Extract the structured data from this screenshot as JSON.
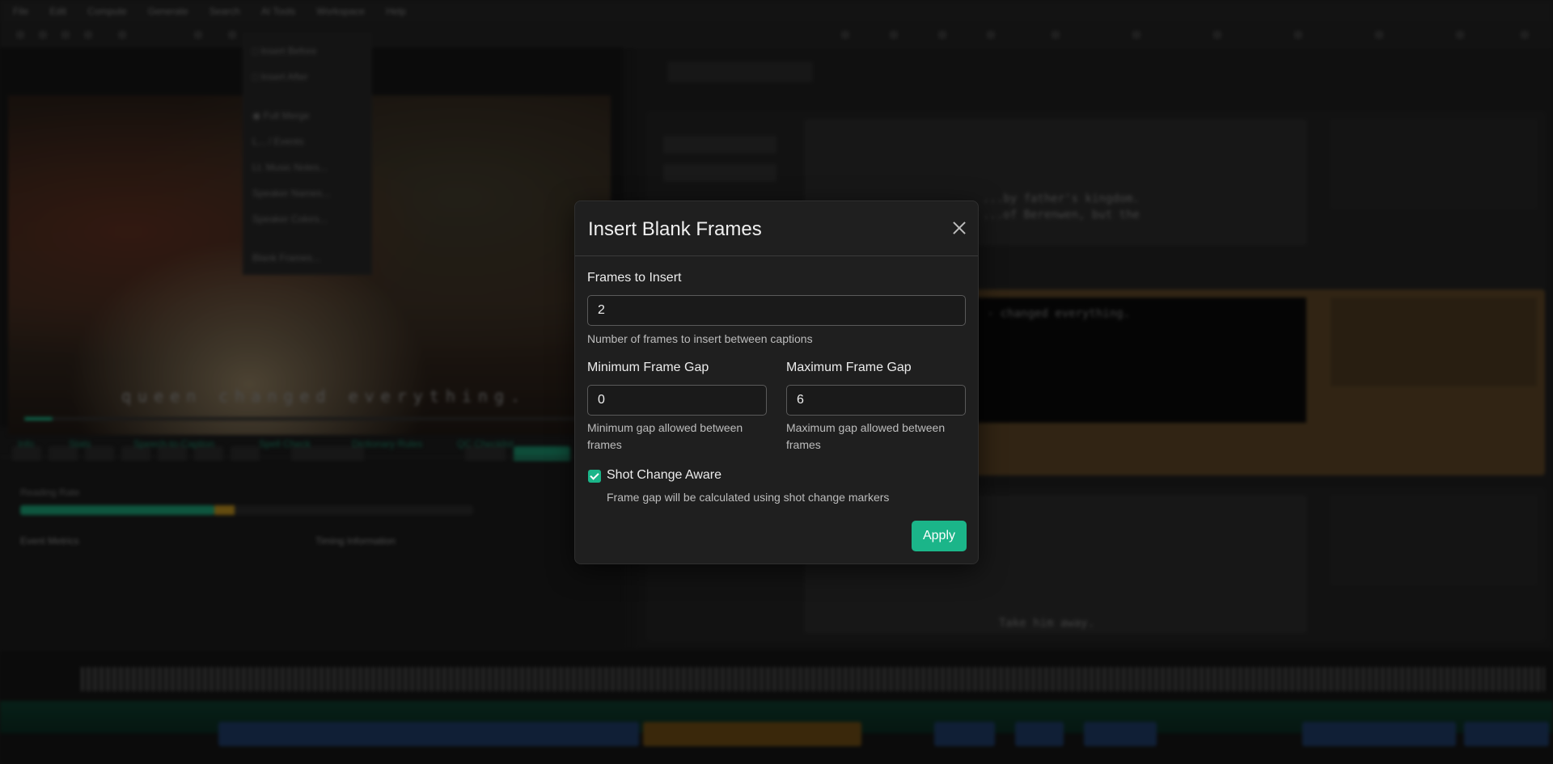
{
  "background": {
    "menu": [
      "File",
      "Edit",
      "Compute",
      "Generate",
      "Search",
      "AI Tools",
      "Workspace",
      "Help"
    ],
    "subtitle_burn": "queen changed everything.",
    "tabs": [
      "Info",
      "Stats",
      "Speech-to-Caption",
      "Spell Check",
      "Dictionary Rules",
      "QC Checklist"
    ],
    "cue_text_1": "...by father's kingdom.",
    "cue_text_1b": "...of Berenwen, but the",
    "cue_text_2": "- changed everything.",
    "cue_text_3": "Take him away.",
    "left_status": "Reading Rate",
    "left_metric_title": "Event Metrics",
    "timing_title": "Timing Information"
  },
  "dialog": {
    "title": "Insert Blank Frames",
    "frames_to_insert": {
      "label": "Frames to Insert",
      "value": "2",
      "help": "Number of frames to insert between captions"
    },
    "min_gap": {
      "label": "Minimum Frame Gap",
      "value": "0",
      "help_line1": "Minimum gap allowed between",
      "help_line2": "frames"
    },
    "max_gap": {
      "label": "Maximum Frame Gap",
      "value": "6",
      "help_line1": "Maximum gap allowed between",
      "help_line2": "frames"
    },
    "shot_change": {
      "label": "Shot Change Aware",
      "checked": true,
      "help": "Frame gap will be calculated using shot change markers"
    },
    "apply_label": "Apply"
  },
  "colors": {
    "accent": "#1bb589",
    "dialog_bg": "#1f1f1f",
    "active_cue": "#5a4325"
  }
}
